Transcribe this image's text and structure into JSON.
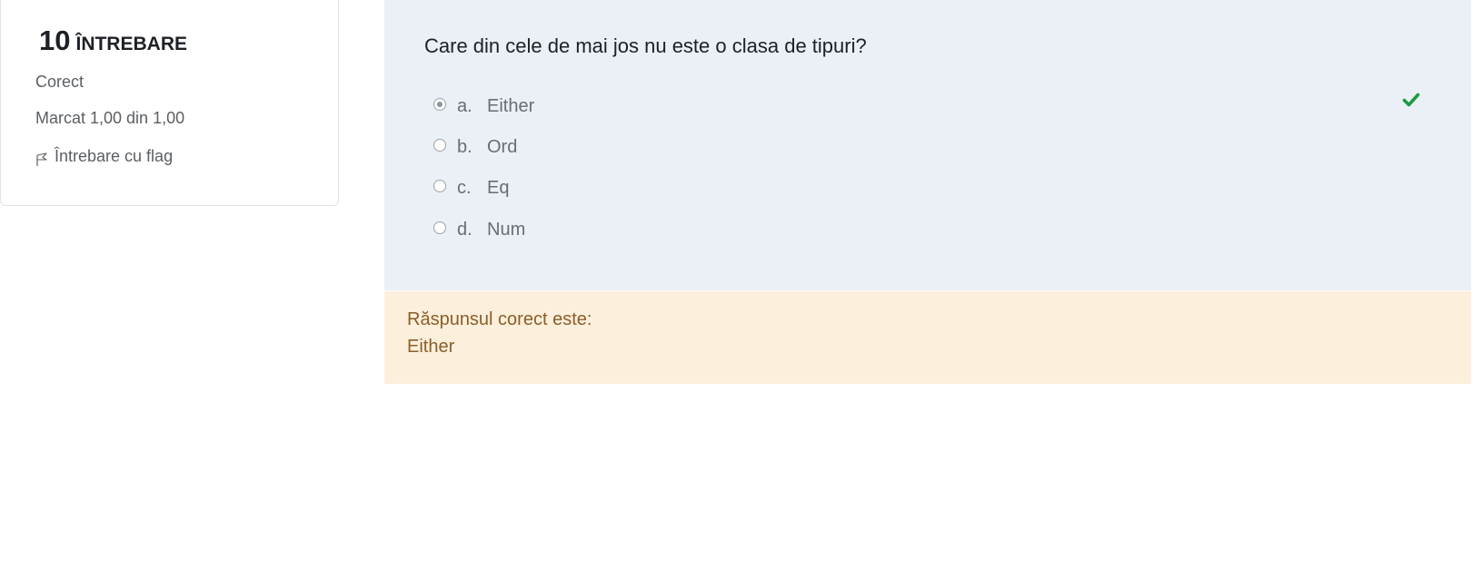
{
  "question_info": {
    "number": "10",
    "label": "ÎNTREBARE",
    "state": "Corect",
    "grade": "Marcat 1,00 din 1,00",
    "flag_label": "Întrebare cu flag",
    "flag_icon": "flag-outline-icon"
  },
  "question": {
    "text": "Care din cele de mai jos nu este o clasa de tipuri?",
    "options": [
      {
        "letter": "a.",
        "text": "Either",
        "selected": true
      },
      {
        "letter": "b.",
        "text": "Ord",
        "selected": false
      },
      {
        "letter": "c.",
        "text": "Eq",
        "selected": false
      },
      {
        "letter": "d.",
        "text": "Num",
        "selected": false
      }
    ],
    "correct_icon": "checkmark-icon",
    "correct_icon_color": "#1e9b42"
  },
  "feedback": {
    "label": "Răspunsul corect este:",
    "answer": "Either"
  },
  "colors": {
    "formulation_bg": "#ebeff6",
    "feedback_bg": "#fcefdc",
    "feedback_text": "#8a5e27"
  }
}
